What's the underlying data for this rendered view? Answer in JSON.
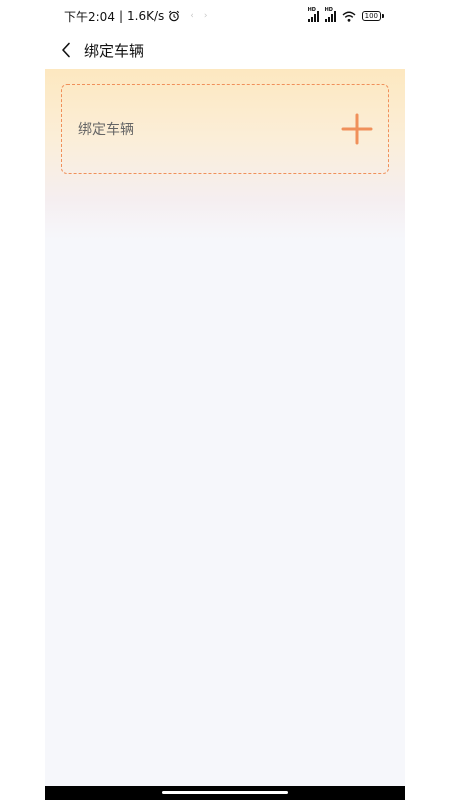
{
  "status_bar": {
    "time": "下午2:04",
    "net_speed": "1.6K/s",
    "signal_label": "HD",
    "battery": "100"
  },
  "header": {
    "title": "绑定车辆"
  },
  "card": {
    "label": "绑定车辆"
  },
  "colors": {
    "accent": "#f0905a",
    "background": "#f6f7fb"
  }
}
